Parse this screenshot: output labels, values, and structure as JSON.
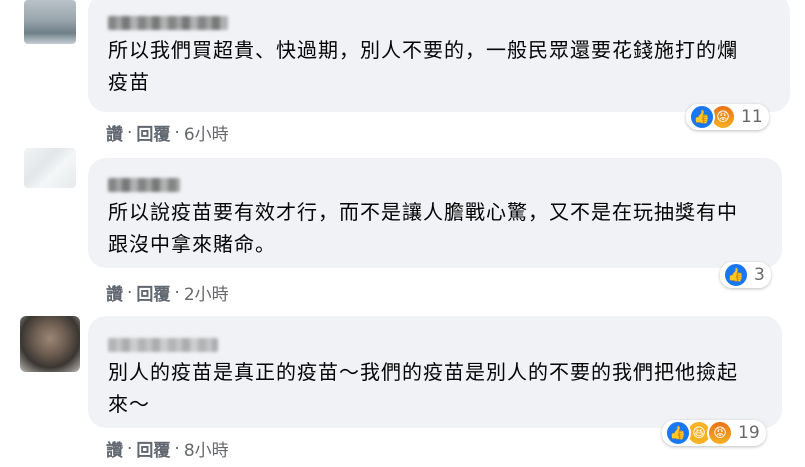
{
  "comments": [
    {
      "text": "所以我們買超貴、快過期，別人不要的，一般民眾還要花錢施打的爛疫苗",
      "reaction_count": "11",
      "reactions": [
        "like-icon",
        "angry-icon"
      ],
      "like_label": "讚",
      "reply_label": "回覆",
      "time": "6小時"
    },
    {
      "text": "所以說疫苗要有效才行，而不是讓人膽戰心驚，又不是在玩抽獎有中跟沒中拿來賭命。",
      "reaction_count": "3",
      "reactions": [
        "like-icon"
      ],
      "like_label": "讚",
      "reply_label": "回覆",
      "time": "2小時"
    },
    {
      "text": "別人的疫苗是真正的疫苗～我們的疫苗是別人的不要的我們把他撿起來～",
      "reaction_count": "19",
      "reactions": [
        "like-icon",
        "haha-icon",
        "angry-icon"
      ],
      "like_label": "讚",
      "reply_label": "回覆",
      "time": "8小時"
    }
  ],
  "colors": {
    "bubble": "#f0f2f5",
    "like_blue": "#1877f2",
    "meta_gray": "#65676b"
  }
}
